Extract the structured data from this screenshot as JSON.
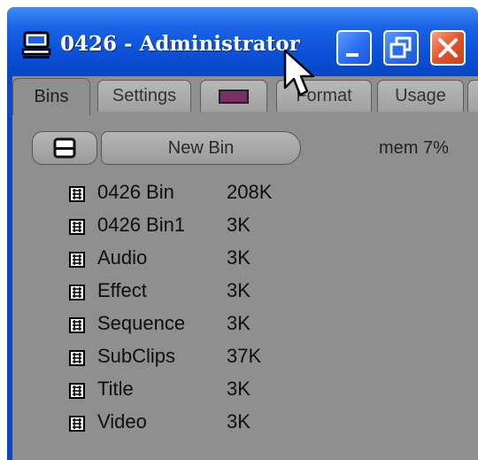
{
  "window": {
    "title": "0426 - Administrator"
  },
  "tabs": [
    {
      "label": "Bins",
      "active": true
    },
    {
      "label": "Settings",
      "active": false
    },
    {
      "label": "",
      "icon": "color-swatch-icon",
      "swatch_color": "#7a2e66",
      "active": false
    },
    {
      "label": "Format",
      "active": false
    },
    {
      "label": "Usage",
      "active": false
    }
  ],
  "toolbar": {
    "new_bin_label": "New Bin",
    "mem_label": "mem 7%"
  },
  "bins": [
    {
      "name": "0426 Bin",
      "size": "208K"
    },
    {
      "name": "0426 Bin1",
      "size": "3K"
    },
    {
      "name": "Audio",
      "size": "3K"
    },
    {
      "name": "Effect",
      "size": "3K"
    },
    {
      "name": "Sequence",
      "size": "3K"
    },
    {
      "name": "SubClips",
      "size": "37K"
    },
    {
      "name": "Title",
      "size": "3K"
    },
    {
      "name": "Video",
      "size": "3K"
    }
  ],
  "colors": {
    "titlebar": "#0b4fd6",
    "client": "#8f8f8f",
    "close_button": "#e2552c"
  }
}
